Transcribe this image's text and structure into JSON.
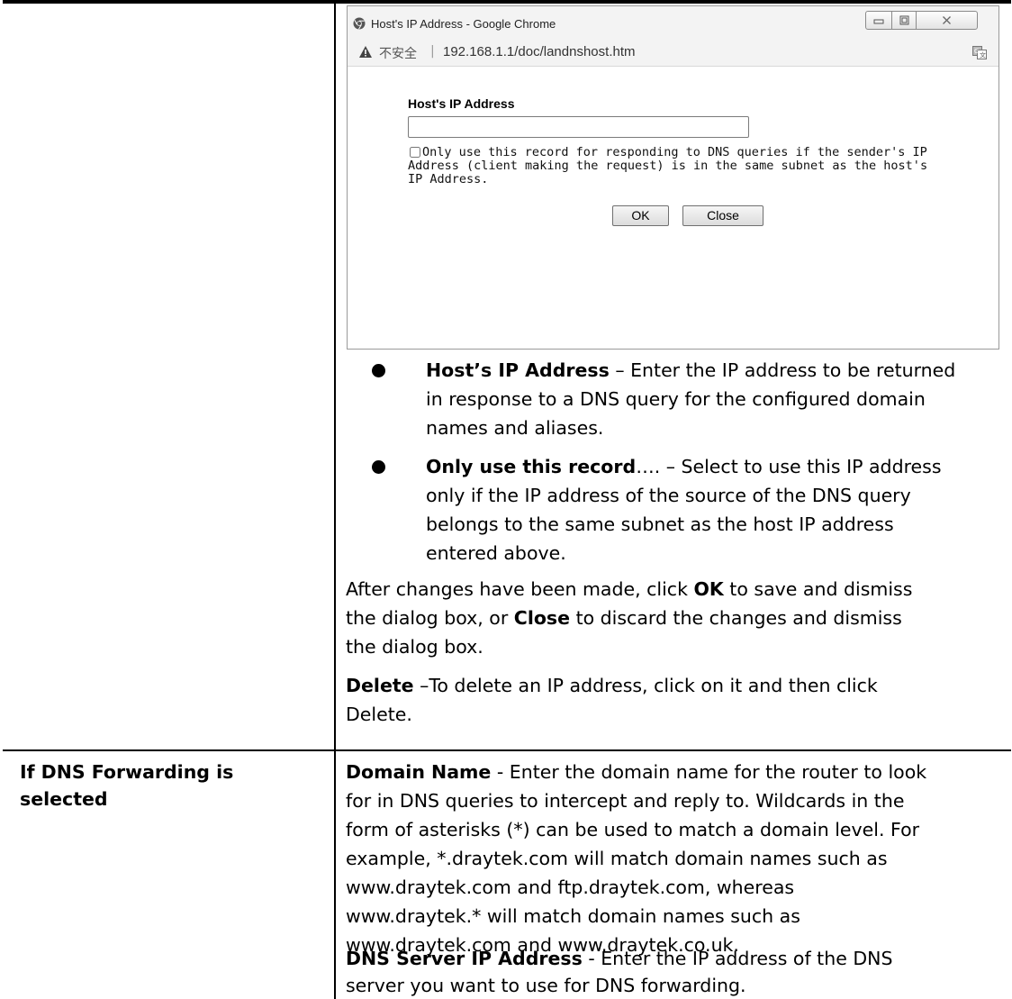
{
  "popup": {
    "window_title": "Host's IP Address - Google Chrome",
    "insecure_label": "不安全",
    "separator": "|",
    "url": "192.168.1.1/doc/landnshost.htm",
    "field_label": "Host's IP Address",
    "field_value": "",
    "checkbox_checked": false,
    "checkbox_text": "Only use this record for responding to DNS queries if the sender's IP Address (client making the request) is in the same subnet as the host's IP Address.",
    "ok_label": "OK",
    "close_label": "Close",
    "icons": [
      "chrome-icon",
      "minimize-icon",
      "maximize-icon",
      "close-icon",
      "warning-icon",
      "translate-icon"
    ]
  },
  "bullets": [
    {
      "term": "Host’s IP Address",
      "lines": [
        " – Enter the IP address to be returned",
        "in response to a DNS query for the configured domain",
        "names and aliases."
      ]
    },
    {
      "term": "Only use this record",
      "lines": [
        "…. – Select to use this IP address",
        "only if the IP address of the source of the DNS query",
        "belongs to the same subnet as the host IP address",
        "entered above."
      ]
    }
  ],
  "after": {
    "line1_a": "After changes have been made, click ",
    "line1_ok": "OK",
    "line1_b": " to save and dismiss",
    "line2_a": "the dialog box, or ",
    "line2_close": "Close",
    "line2_b": " to discard the changes and dismiss",
    "line3": "the dialog box."
  },
  "delete_note": {
    "term": "Delete",
    "line1": " –To delete an IP address, click on it and then click",
    "line2": "Delete."
  },
  "forwarding": {
    "heading_line1": "If DNS Forwarding is",
    "heading_line2": "selected",
    "domain_term": "Domain Name",
    "domain_lines": [
      " - Enter the domain name for the router to look",
      "for in DNS queries to intercept and reply to. Wildcards in the",
      "form of asterisks (*) can be used to match a domain level. For",
      "example, *.draytek.com will match domain names such as",
      "www.draytek.com and ftp.draytek.com, whereas",
      "www.draytek.* will match domain names such as",
      "www.draytek.com and www.draytek.co.uk."
    ],
    "dns_term": "DNS Server IP Address",
    "dns_lines": [
      " - Enter the IP address of the DNS",
      "server you want to use for DNS forwarding."
    ]
  }
}
